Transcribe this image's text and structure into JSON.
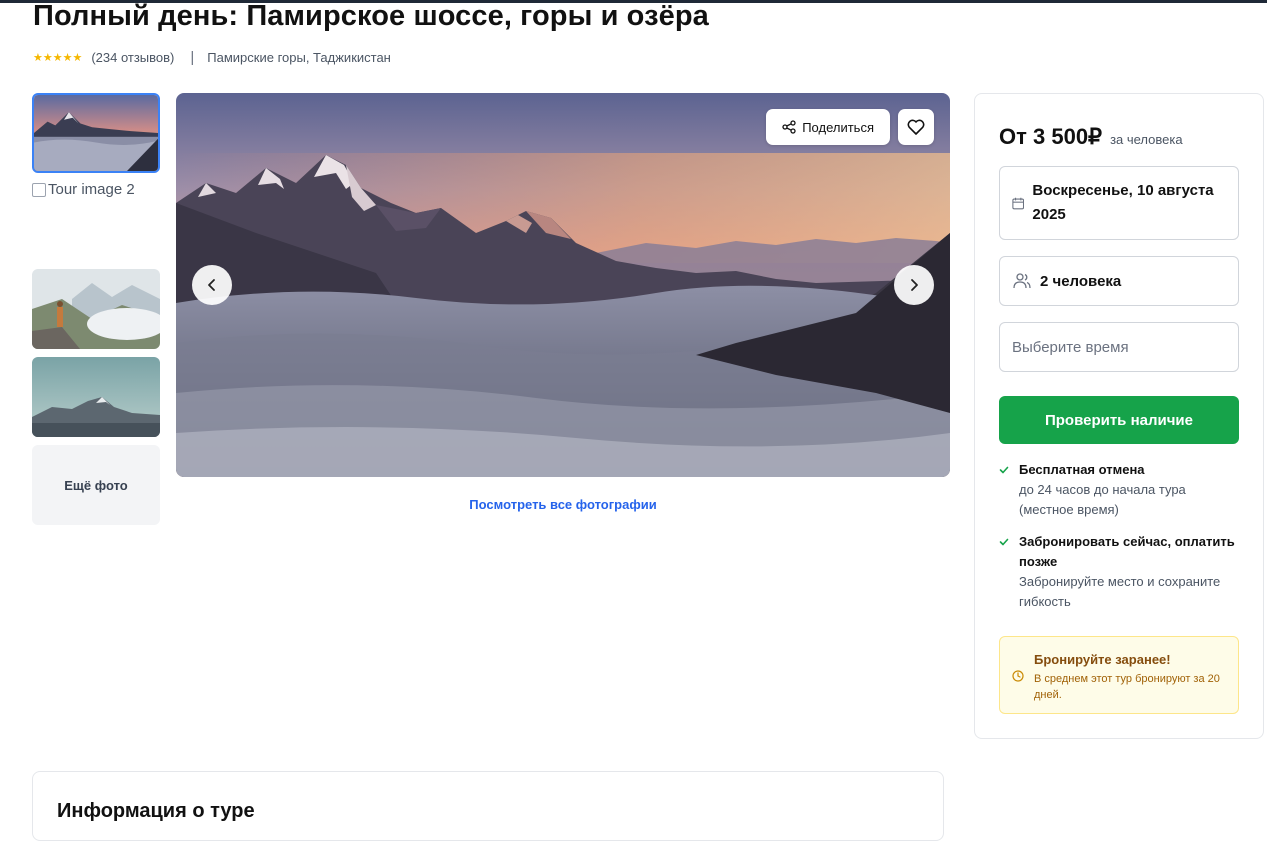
{
  "tour": {
    "title": "Полный день: Памирское шоссе, горы и озёра",
    "rating_stars": "★★★★★",
    "reviews": "(234 отзывов)",
    "separator": "|",
    "location": "Памирские горы, Таджикистан"
  },
  "gallery": {
    "broken_image_alt": "Tour image 2",
    "more_photos_label": "Ещё фото",
    "share_label": "Поделиться",
    "view_all_label": "Посмотреть все фотографии"
  },
  "booking": {
    "price_main": "От 3 500₽",
    "price_sub": "за человека",
    "date_value": "Воскресенье, 10 августа 2025",
    "people_value": "2 человека",
    "time_placeholder": "Выберите время",
    "check_button": "Проверить наличие",
    "benefits": [
      {
        "title": "Бесплатная отмена",
        "desc": "до 24 часов до начала тура (местное время)"
      },
      {
        "title": "Забронировать сейчас, оплатить позже",
        "desc": "Забронируйте место и сохраните гибкость"
      }
    ],
    "notice": {
      "title": "Бронируйте заранее!",
      "desc": "В среднем этот тур бронируют за 20 дней."
    }
  },
  "info": {
    "title": "Информация о туре"
  },
  "colors": {
    "accent_green": "#16a34a",
    "link_blue": "#2563eb",
    "star_yellow": "#f5b700"
  }
}
